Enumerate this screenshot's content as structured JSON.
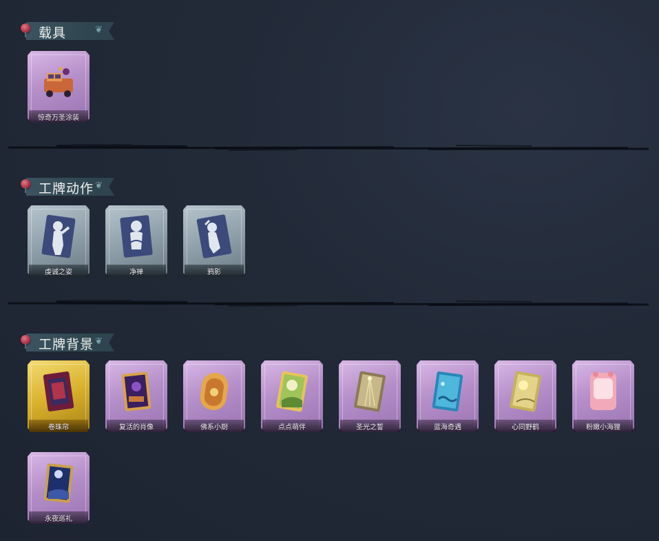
{
  "sections": [
    {
      "title": "载具",
      "items": [
        {
          "label": "惊奇万圣涂装",
          "frame": "purple",
          "icon": "vehicle-icon"
        }
      ]
    },
    {
      "title": "工牌动作",
      "items": [
        {
          "label": "虔诚之姿",
          "frame": "grey",
          "icon": "pose-silhouette-icon"
        },
        {
          "label": "净禅",
          "frame": "grey",
          "icon": "pose-silhouette-icon"
        },
        {
          "label": "鸦影",
          "frame": "grey",
          "icon": "pose-silhouette-icon"
        }
      ]
    },
    {
      "title": "工牌背景",
      "items": [
        {
          "label": "卷珠帘",
          "frame": "gold",
          "icon": "badge-background-icon"
        },
        {
          "label": "复活的肖像",
          "frame": "purple",
          "icon": "badge-background-icon"
        },
        {
          "label": "佛系小厨",
          "frame": "purple",
          "icon": "badge-background-icon"
        },
        {
          "label": "点点萌伴",
          "frame": "purple",
          "icon": "badge-background-icon"
        },
        {
          "label": "圣光之誓",
          "frame": "purple",
          "icon": "badge-background-icon"
        },
        {
          "label": "蓝海奇遇",
          "frame": "purple",
          "icon": "badge-background-icon"
        },
        {
          "label": "心同野鹤",
          "frame": "purple",
          "icon": "badge-background-icon"
        },
        {
          "label": "粉嫩小海狸",
          "frame": "purple",
          "icon": "badge-background-icon"
        },
        {
          "label": "永夜巡礼",
          "frame": "purple",
          "icon": "badge-background-icon"
        }
      ]
    }
  ],
  "colors": {
    "background": "#222a38",
    "frame_purple": "#b58fc9",
    "frame_gold": "#d8b02c",
    "frame_grey": "#8c9ca6",
    "header_ribbon": "#3c5460"
  }
}
